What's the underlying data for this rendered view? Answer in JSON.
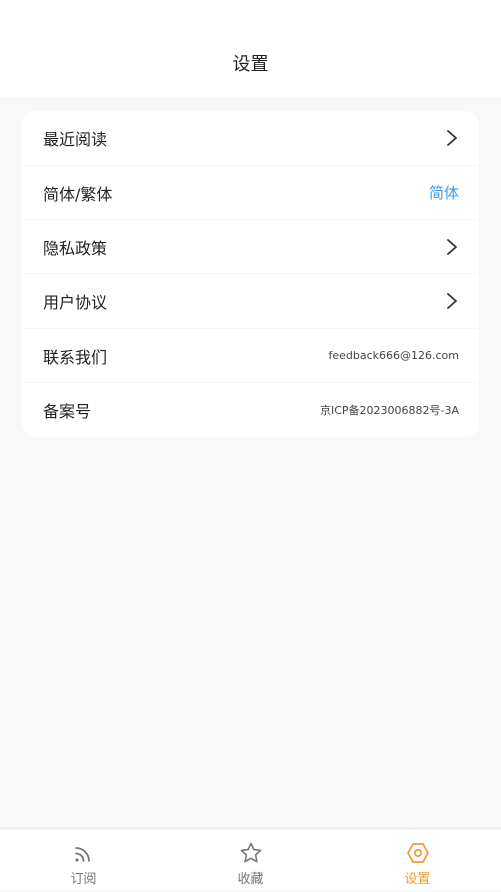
{
  "header": {
    "title": "设置"
  },
  "settings": {
    "rows": [
      {
        "label": "最近阅读"
      },
      {
        "label": "简体/繁体",
        "value": "简体"
      },
      {
        "label": "隐私政策"
      },
      {
        "label": "用户协议"
      },
      {
        "label": "联系我们",
        "value": "feedback666@126.com"
      },
      {
        "label": "备案号",
        "value": "京ICP备2023006882号-3A"
      }
    ]
  },
  "tabs": [
    {
      "label": "订阅",
      "icon": "rss-icon"
    },
    {
      "label": "收藏",
      "icon": "star-icon"
    },
    {
      "label": "设置",
      "icon": "hexagon-settings-icon",
      "active": true
    }
  ],
  "colors": {
    "accent": "#f29b3a",
    "link": "#3a9be8",
    "background": "#f8f8f8",
    "card": "#ffffff"
  }
}
